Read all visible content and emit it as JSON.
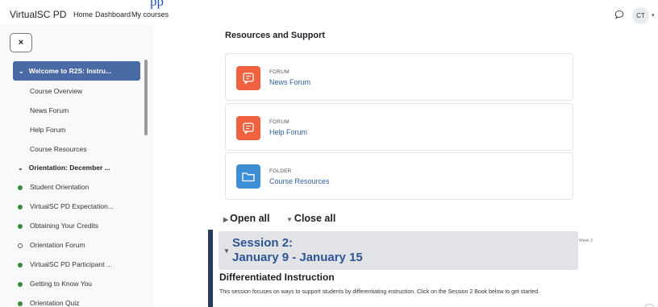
{
  "topnav": {
    "site_name": "VirtualSC PD",
    "links": [
      "Home",
      "Dashboard",
      "My courses"
    ],
    "cut_text": "pp",
    "avatar_initials": "CT"
  },
  "drawer": {
    "close_glyph": "×",
    "active_section": "Welcome to R2S: Instru...",
    "welcome_items": [
      "Course Overview",
      "News Forum",
      "Help Forum",
      "Course Resources"
    ],
    "orientation_section": "Orientation: December ...",
    "orientation_items": [
      {
        "label": "Student Orientation",
        "status": "done"
      },
      {
        "label": "VirtualSC PD Expectation...",
        "status": "done"
      },
      {
        "label": "Obtaining Your Credits",
        "status": "done"
      },
      {
        "label": "Orientation Forum",
        "status": "open"
      },
      {
        "label": "VirtualSC PD Participant ...",
        "status": "done"
      },
      {
        "label": "Getting to Know You",
        "status": "done"
      },
      {
        "label": "Orientation Quiz",
        "status": "done"
      }
    ]
  },
  "main": {
    "section_title": "Resources and Support",
    "activities": [
      {
        "type": "FORUM",
        "name": "News Forum",
        "icon": "forum-icon"
      },
      {
        "type": "FORUM",
        "name": "Help Forum",
        "icon": "forum-icon"
      },
      {
        "type": "FOLDER",
        "name": "Course Resources",
        "icon": "folder-icon"
      }
    ],
    "open_all": "Open all",
    "close_all": "Close all",
    "session": {
      "line1": "Session 2:",
      "line2": "January 9 - January 15",
      "week_label": "Week 3"
    },
    "diff_title": "Differentiated Instruction",
    "diff_text": "This session focuses on ways to support students by differentiating instruction. Click on the Session 2 Book below to get started."
  },
  "colors": {
    "active_section_bg": "#4a6aa5",
    "forum_icon_bg": "#f0613f",
    "folder_icon_bg": "#3d8fd6",
    "link": "#2d5fa3",
    "session_bar": "#283b5f"
  }
}
